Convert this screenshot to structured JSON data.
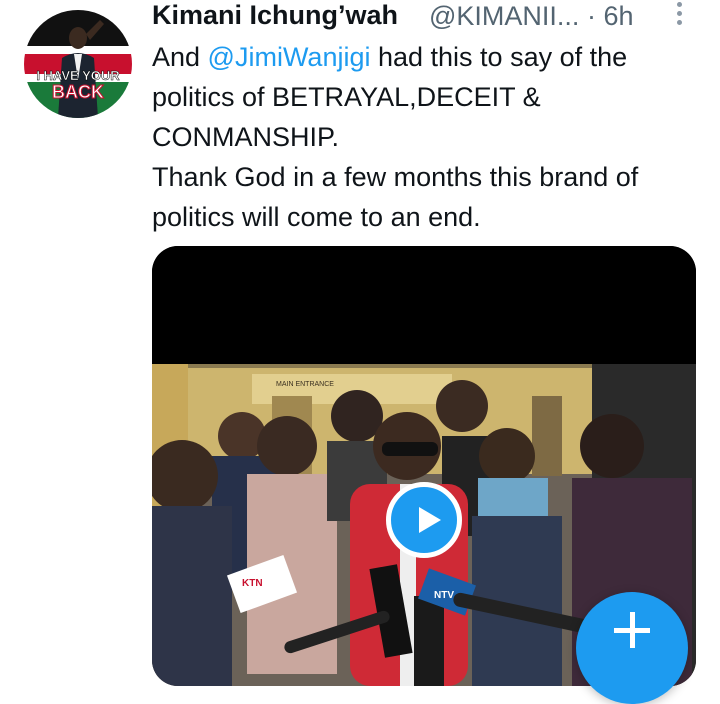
{
  "author": {
    "name": "Kimani Ichung’wah",
    "handle": "@KIMANII...",
    "separator": "·",
    "time": "6h",
    "avatar_text": "I HAVE YOUR BACK"
  },
  "tweet": {
    "prefix": "And ",
    "mention": "@JimiWanjigi",
    "line1_rest": " had this to say of the politics of BETRAYAL,DECEIT & CONMANSHIP.",
    "line2": "Thank God in a few months this brand of politics will come to an end."
  },
  "media": {
    "type": "video",
    "sign_text": "MAIN ENTRANCE",
    "mic_labels": [
      "NTV",
      "KTN"
    ]
  },
  "icons": {
    "more": "more-vertical-icon",
    "play": "play-icon",
    "compose": "plus-icon"
  },
  "colors": {
    "accent": "#1d9bf0",
    "text": "#0f1419",
    "secondary": "#536471"
  }
}
